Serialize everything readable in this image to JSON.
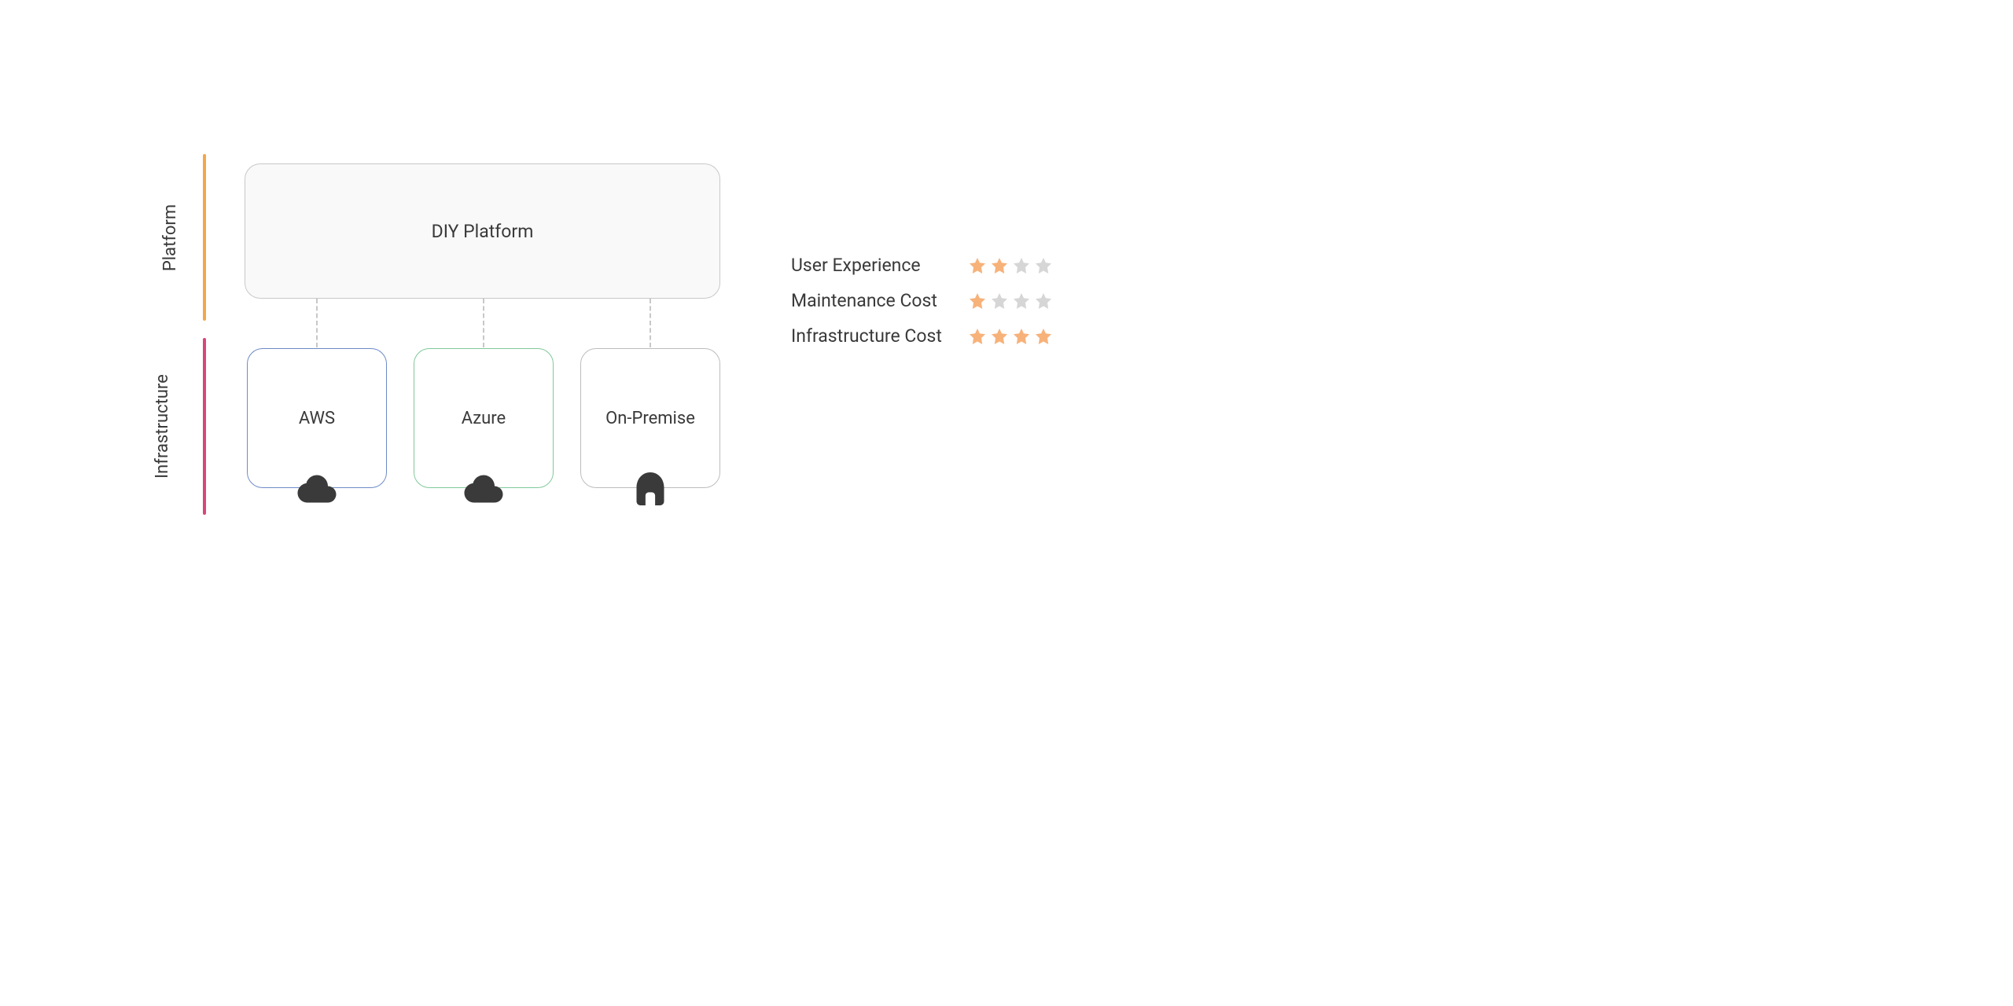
{
  "sections": {
    "platform": {
      "label": "Platform",
      "bar_color": "#f4a74a"
    },
    "infrastructure": {
      "label": "Infrastructure",
      "bar_color": "#d9467a"
    }
  },
  "platform_box": {
    "title": "DIY Platform"
  },
  "infrastructure_boxes": [
    {
      "name": "AWS",
      "icon": "cloud",
      "border_color": "#6d8bc7"
    },
    {
      "name": "Azure",
      "icon": "cloud",
      "border_color": "#81c99a"
    },
    {
      "name": "On-Premise",
      "icon": "home",
      "border_color": "#bdbdbd"
    }
  ],
  "ratings": [
    {
      "label": "User Experience",
      "value": 2,
      "max": 4
    },
    {
      "label": "Maintenance Cost",
      "value": 1,
      "max": 4
    },
    {
      "label": "Infrastructure Cost",
      "value": 4,
      "max": 4
    }
  ],
  "colors": {
    "star_filled": "#f7b27a",
    "star_empty": "#d6d6d6",
    "icon_fill": "#3a3a3a"
  }
}
